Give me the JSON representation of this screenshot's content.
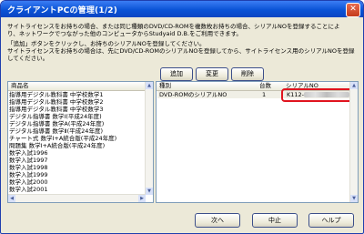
{
  "window": {
    "title": "クライアントPCの管理(1/2)",
    "close_glyph": "✕"
  },
  "message": {
    "line1": "サイトライセンスをお持ちの場合、または同じ種類のDVD/CD-ROMを複数枚お持ちの場合、シリアルNOを登録することによ",
    "line2": "り、ネットワークでつながった他のコンピュータからStudyaid D.B.をご利用できます。",
    "line3": "「追加」ボタンをクリックし、お持ちのシリアルNOを登録してください。",
    "line4": "サイトライセンスをお持ちの場合は、先にDVD/CD-ROMのシリアルNOを登録してから、サイトライセンス用のシリアルNOを登録",
    "line5": "してください。"
  },
  "toolbar": {
    "add_label": "追加",
    "change_label": "変更",
    "delete_label": "削除"
  },
  "product_list": {
    "header": "商品名",
    "items": [
      "指導用デジタル教科書 中学校数学1",
      "指導用デジタル教科書 中学校数学2",
      "指導用デジタル教科書 中学校数学3",
      "デジタル指導書 数学Ⅰ(平成24年度)",
      "デジタル指導書 数学A(平成24年度)",
      "デジタル指導書 数学Ⅱ(平成24年度)",
      "チャート式 数学Ⅰ+A統合版(平成24年度)",
      "問題集 数学Ⅰ+A統合版(平成24年度)",
      "数学入試1996",
      "数学入試1997",
      "数学入試1998",
      "数学入試1999",
      "数学入試2000",
      "数学入試2001"
    ]
  },
  "serial_table": {
    "columns": {
      "type": "種別",
      "count": "台数",
      "serial": "シリアルNO"
    },
    "rows": [
      {
        "type": "DVD-ROMのシリアルNO",
        "count": "1",
        "serial": "K112-"
      }
    ]
  },
  "footer": {
    "next_label": "次へ",
    "cancel_label": "中止",
    "help_label": "ヘルプ"
  },
  "colors": {
    "title_bar": "#0a53d6",
    "highlight": "#e0141f",
    "selection": "#316ac5"
  }
}
